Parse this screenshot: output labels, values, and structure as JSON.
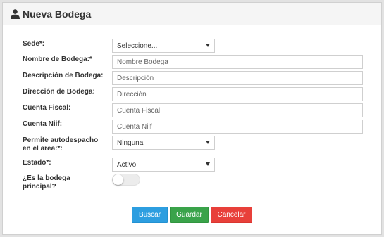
{
  "header": {
    "title": "Nueva Bodega",
    "icon": "user-icon"
  },
  "form": {
    "sede": {
      "label": "Sede*:",
      "value": "Seleccione..."
    },
    "nombre": {
      "label": "Nombre de Bodega:*",
      "placeholder": "Nombre Bodega"
    },
    "descripcion": {
      "label": "Descripción de Bodega:",
      "placeholder": "Descripción"
    },
    "direccion": {
      "label": "Dirección de Bodega:",
      "placeholder": "Dirección"
    },
    "cuenta_fiscal": {
      "label": "Cuenta Fiscal:",
      "placeholder": "Cuenta Fiscal"
    },
    "cuenta_niif": {
      "label": "Cuenta Niif:",
      "placeholder": "Cuenta Niif"
    },
    "autodespacho": {
      "label_line1": "Permite autodespacho",
      "label_line2": "en el area:*:",
      "value": "Ninguna"
    },
    "estado": {
      "label": "Estado*:",
      "value": "Activo"
    },
    "principal": {
      "label_line1": "¿Es la bodega",
      "label_line2": "principal?",
      "checked": false
    }
  },
  "buttons": {
    "buscar": "Buscar",
    "guardar": "Guardar",
    "cancelar": "Cancelar"
  },
  "colors": {
    "buscar": "#2d9ee0",
    "guardar": "#3aa34a",
    "cancelar": "#e8403a"
  }
}
